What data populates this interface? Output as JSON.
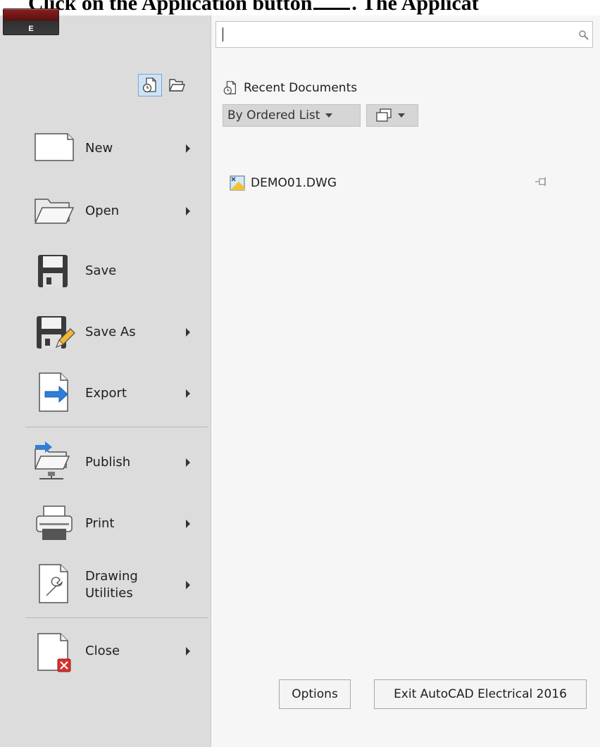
{
  "doc_title": {
    "before": "Click on the Application button",
    "after": ". The Applicat"
  },
  "app_button": {
    "label": "E"
  },
  "search": {
    "value": "",
    "placeholder": ""
  },
  "menu_items": [
    {
      "label": "New",
      "icon": "new-document-icon",
      "has_submenu": true
    },
    {
      "label": "Open",
      "icon": "open-folder-icon",
      "has_submenu": true
    },
    {
      "label": "Save",
      "icon": "floppy-disk-icon",
      "has_submenu": false
    },
    {
      "label": "Save As",
      "icon": "save-as-icon",
      "has_submenu": true
    },
    {
      "label": "Export",
      "icon": "export-icon",
      "has_submenu": true
    },
    {
      "label": "Publish",
      "icon": "publish-icon",
      "has_submenu": true
    },
    {
      "label": "Print",
      "icon": "printer-icon",
      "has_submenu": true
    },
    {
      "label_line1": "Drawing",
      "label_line2": "Utilities",
      "icon": "drawing-utilities-icon",
      "has_submenu": true
    },
    {
      "label": "Close",
      "icon": "close-document-icon",
      "has_submenu": true
    }
  ],
  "recent": {
    "title": "Recent Documents",
    "order_dropdown": "By Ordered List",
    "documents": [
      {
        "name": "DEMO01.DWG",
        "pinned": false
      }
    ]
  },
  "footer": {
    "options_label": "Options",
    "exit_label": "Exit AutoCAD Electrical 2016"
  },
  "colors": {
    "left_panel": "#dcdcdc",
    "right_panel": "#f6f6f6",
    "accent_blue": "#2f7ed8",
    "close_red": "#d9302c"
  }
}
